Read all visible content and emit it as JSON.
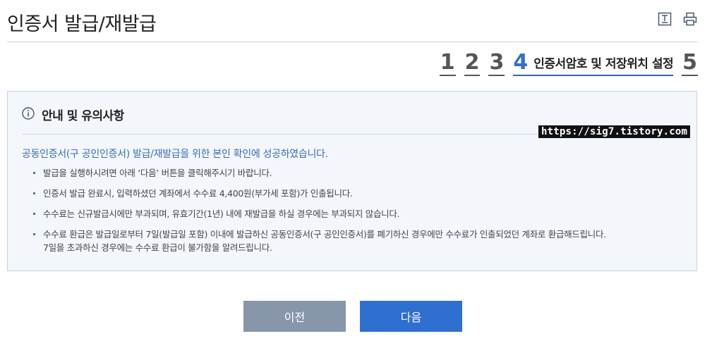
{
  "header": {
    "title": "인증서 발급/재발급",
    "icons": [
      "download-icon",
      "print-icon"
    ]
  },
  "steps": {
    "items": [
      "1",
      "2",
      "3",
      "4",
      "5"
    ],
    "current_index": 4,
    "current_label": "인증서암호 및 저장위치 설정"
  },
  "notice": {
    "title": "안내 및 유의사항",
    "watermark": "https://sig7.tistory.com",
    "lead": "공동인증서(구 공인인증서) 발급/재발급을 위한 본인 확인에 성공하였습니다.",
    "items": [
      "발급을 실행하시려면 아래 ‘다음’ 버튼을 클릭해주시기 바랍니다.",
      "인증서 발급 완료시, 입력하셨던 계좌에서 수수료 4,400원(부가세 포함)가 인출됩니다.",
      "수수료는 신규발급시에만 부과되며, 유효기간(1년) 내에 재발급을 하실 경우에는 부과되지 않습니다.",
      "수수료 환급은 발급일로부터 7일(발급일 포함) 이내에 발급하신 공동인증서(구 공인인증서)를 폐기하신 경우에만 수수료가 인출되었던 계좌로 환급해드립니다.",
      "7일을 초과하신 경우에는 수수료 환급이 불가함을 알려드립니다."
    ]
  },
  "buttons": {
    "prev": "이전",
    "next": "다음"
  },
  "colors": {
    "accent": "#2f6fcf",
    "step_active": "#3370c8",
    "prev_button": "#8796aa",
    "notice_bg": "#f3f6fa"
  }
}
